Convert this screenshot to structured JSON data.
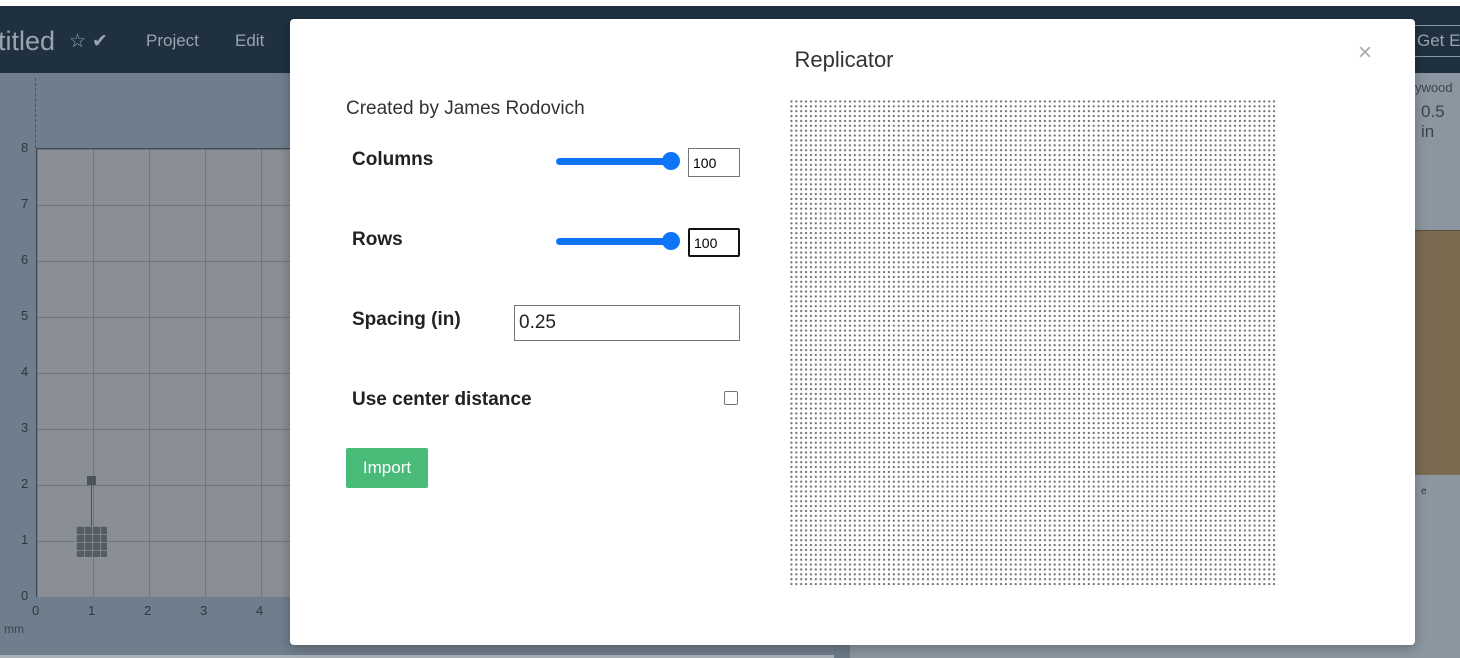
{
  "app": {
    "title": "titled",
    "nav": [
      "Project",
      "Edit"
    ],
    "cta": "Get Ea",
    "right_panel": [
      "ywood",
      "0.5 in",
      "e"
    ],
    "unit": "mm"
  },
  "canvas": {
    "y_ticks": [
      "8",
      "7",
      "6",
      "5",
      "4",
      "3",
      "2",
      "1",
      "0"
    ],
    "x_ticks": [
      "0",
      "1",
      "2",
      "3",
      "4"
    ]
  },
  "modal": {
    "title": "Replicator",
    "close": "×",
    "credit": "Created by James Rodovich",
    "columns": {
      "label": "Columns",
      "value": "100",
      "slider_fraction": 1.0
    },
    "rows": {
      "label": "Rows",
      "value": "100",
      "slider_fraction": 1.0
    },
    "spacing": {
      "label": "Spacing (in)",
      "value": "0.25"
    },
    "center_distance": {
      "label": "Use center distance",
      "checked": false
    },
    "import_label": "Import",
    "preview": {
      "columns": 100,
      "rows": 100
    }
  },
  "colors": {
    "slider": "#0d75f6",
    "import_button": "#48bb78",
    "navbar": "#1f3040"
  },
  "icons": [
    "star-icon",
    "check-icon",
    "close-icon"
  ]
}
